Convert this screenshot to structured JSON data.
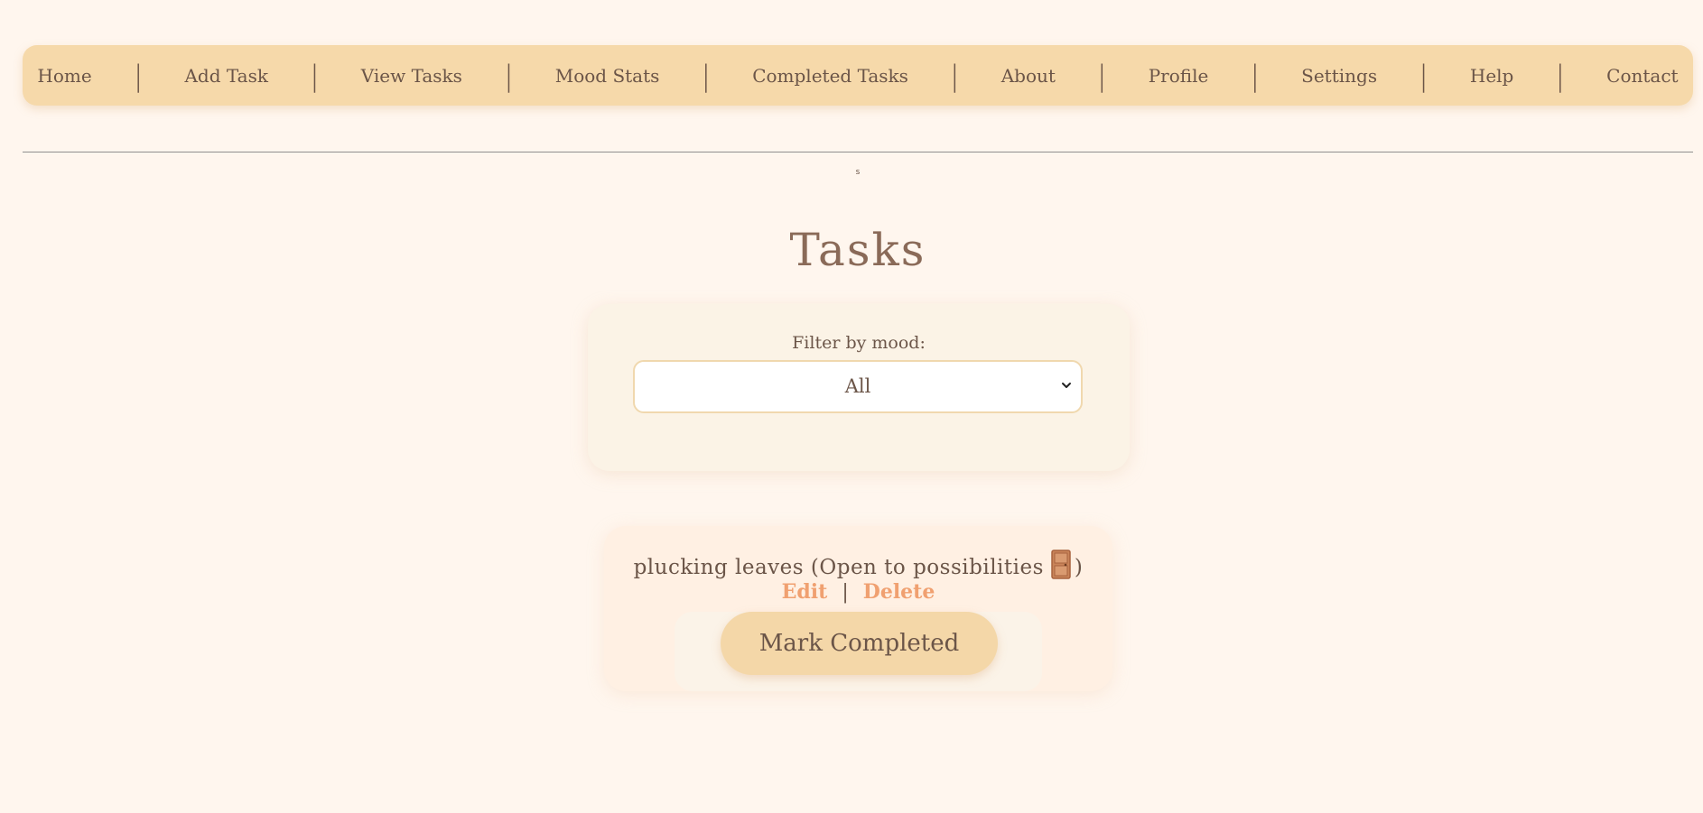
{
  "nav": {
    "items": [
      "Home",
      "Add Task",
      "View Tasks",
      "Mood Stats",
      "Completed Tasks",
      "About",
      "Profile",
      "Settings",
      "Help",
      "Contact"
    ],
    "separator": "|"
  },
  "stray_text": "s",
  "page": {
    "title": "Tasks"
  },
  "filter": {
    "label": "Filter by mood:",
    "selected": "All",
    "chevron_icon": "chevron-down-icon"
  },
  "tasks": [
    {
      "text": "plucking leaves (Open to possibilities",
      "emoji_icon": "door-icon",
      "text_close": ")",
      "edit_label": "Edit",
      "separator": "|",
      "delete_label": "Delete",
      "complete_label": "Mark Completed"
    }
  ],
  "colors": {
    "background": "#fff6ee",
    "nav_background": "#f6d9aa",
    "text": "#6b5548",
    "accent_link": "#f0a070",
    "button": "#f4d7a8"
  }
}
